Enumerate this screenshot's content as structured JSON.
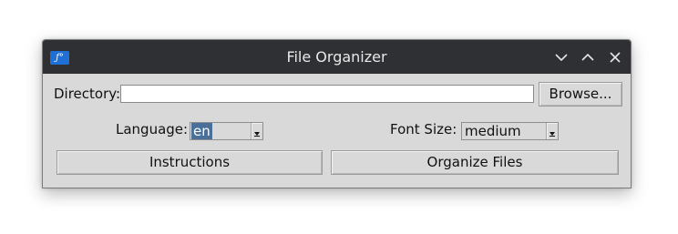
{
  "window": {
    "title": "File Organizer",
    "app_icon_glyph": "ƒ°",
    "controls": {
      "minimize_icon": "chevron-down-icon",
      "maximize_icon": "chevron-up-icon",
      "close_icon": "close-icon"
    }
  },
  "directory": {
    "label": "Directory:",
    "value": "",
    "browse_label": "Browse..."
  },
  "language": {
    "label": "Language:",
    "selected": "en"
  },
  "font_size": {
    "label": "Font Size:",
    "selected": "medium"
  },
  "actions": {
    "instructions_label": "Instructions",
    "organize_label": "Organize Files"
  },
  "colors": {
    "titlebar": "#2e3033",
    "window_bg": "#d9d9d9",
    "app_icon": "#1e6fd6",
    "selection": "#4a6f99"
  }
}
